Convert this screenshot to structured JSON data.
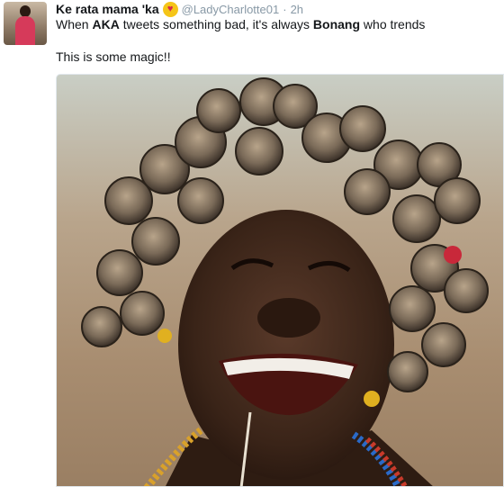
{
  "tweet": {
    "display_name": "Ke rata mama 'ka",
    "handle": "@LadyCharlotte01",
    "separator": "·",
    "time": "2h",
    "text_line1": {
      "part1": "When ",
      "bold1": "AKA",
      "part2": " tweets something bad, it's always ",
      "bold2": "Bonang",
      "part3": " who trends"
    },
    "text_line2": "This is some magic!!"
  },
  "icons": {
    "emoji": "heart-eyes-emoji-icon"
  },
  "colors": {
    "text": "#14171a",
    "muted": "#8899a6",
    "emoji": "#f5c518"
  }
}
